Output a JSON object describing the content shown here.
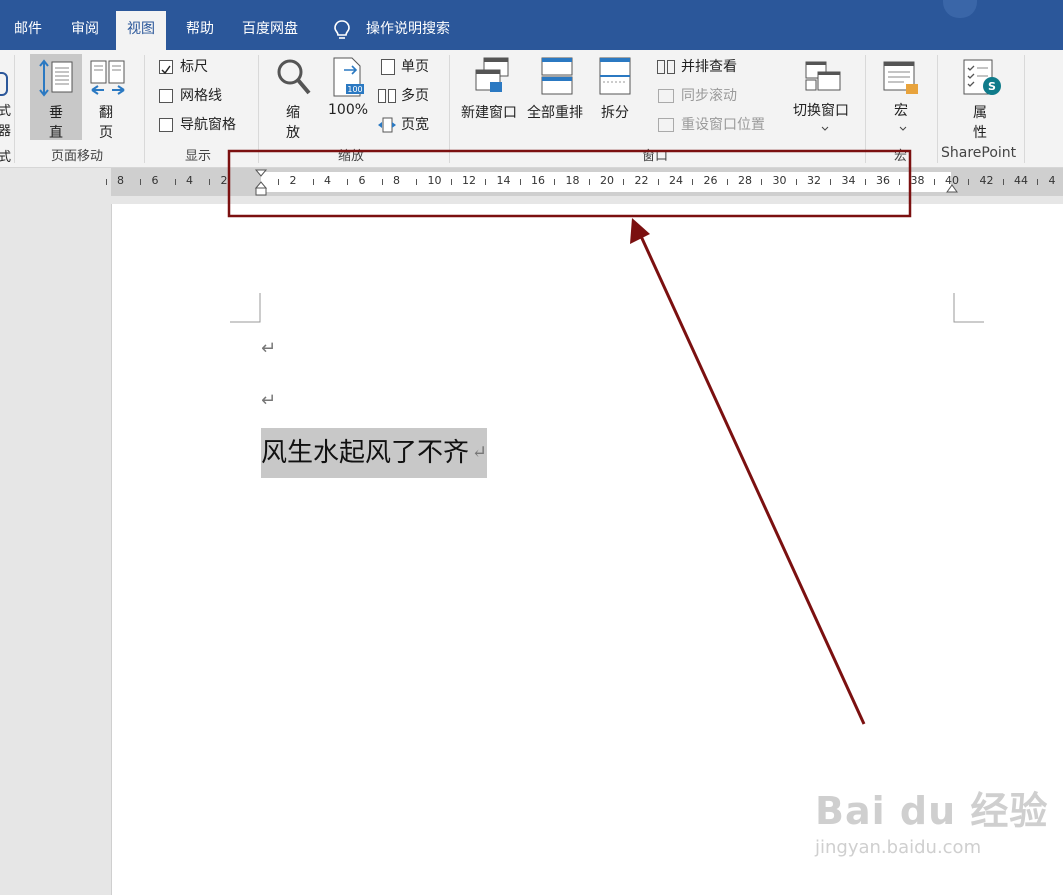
{
  "tabs": {
    "mail": "邮件",
    "review": "审阅",
    "view": "视图",
    "help": "帮助",
    "baidu": "百度网盘",
    "tell_me": "操作说明搜索"
  },
  "ribbon": {
    "partial_left": [
      "式",
      "器",
      "式"
    ],
    "page_move": {
      "vertical": [
        "垂",
        "直"
      ],
      "flip": [
        "翻",
        "页"
      ],
      "label": "页面移动"
    },
    "show": {
      "ruler": "标尺",
      "gridlines": "网格线",
      "nav_pane": "导航窗格",
      "label": "显示",
      "ruler_checked": true
    },
    "zoom": {
      "zoom": [
        "缩",
        "放"
      ],
      "hundred": "100%",
      "hundred_badge": "100",
      "one_page": "单页",
      "multi_page": "多页",
      "page_width": "页宽",
      "label": "缩放"
    },
    "window": {
      "new_window": "新建窗口",
      "arrange_all": "全部重排",
      "split": "拆分",
      "side_by_side": "并排查看",
      "sync_scroll": "同步滚动",
      "reset_pos": "重设窗口位置",
      "switch": "切换窗口",
      "label": "窗口"
    },
    "macro": {
      "macro": "宏",
      "label": "宏"
    },
    "sharepoint": {
      "properties": [
        "属",
        "性"
      ],
      "label": "SharePoint"
    }
  },
  "ruler": {
    "left_numbers": [
      "8",
      "6",
      "4",
      "2"
    ],
    "right_numbers": [
      "2",
      "4",
      "6",
      "8",
      "10",
      "12",
      "14",
      "16",
      "18",
      "20",
      "22",
      "24",
      "26",
      "28",
      "30",
      "32",
      "34",
      "36",
      "38",
      "40",
      "42",
      "44",
      "4"
    ]
  },
  "document": {
    "text": "风生水起风了不齐",
    "para_mark": "↵"
  },
  "watermark": {
    "line1": "Bai du 经验",
    "line2": "jingyan.baidu.com"
  },
  "colors": {
    "title_bar": "#2b579a",
    "annotation": "#7b1010"
  }
}
